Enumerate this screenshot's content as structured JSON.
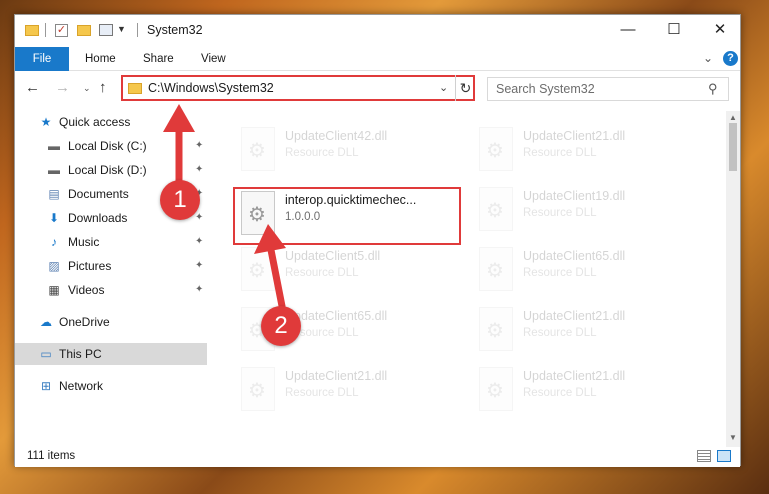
{
  "titlebar": {
    "title": "System32",
    "quick_access_icons": [
      "folder-icon",
      "properties-check-icon",
      "new-folder-icon",
      "properties-icon",
      "customize-dropdown-icon"
    ],
    "minimize": "—",
    "maximize": "☐",
    "close": "✕"
  },
  "ribbon": {
    "tabs": [
      "File",
      "Home",
      "Share",
      "View"
    ],
    "expand": "⌄",
    "help": "?"
  },
  "nav": {
    "back": "←",
    "forward": "→",
    "recent": "⌄",
    "up": "↑",
    "address": "C:\\Windows\\System32",
    "address_dropdown": "⌄",
    "refresh": "↻",
    "search_placeholder": "Search System32",
    "search_icon": "⚲"
  },
  "sidebar": {
    "items": [
      {
        "label": "Quick access",
        "icon": "star-icon",
        "glyph": "★",
        "pinned": false
      },
      {
        "label": "Local Disk (C:)",
        "icon": "drive-icon",
        "glyph": "▬",
        "pinned": true
      },
      {
        "label": "Local Disk (D:)",
        "icon": "drive-icon",
        "glyph": "▬",
        "pinned": true
      },
      {
        "label": "Documents",
        "icon": "documents-icon",
        "glyph": "▤",
        "pinned": true
      },
      {
        "label": "Downloads",
        "icon": "download-icon",
        "glyph": "⬇",
        "pinned": true
      },
      {
        "label": "Music",
        "icon": "music-icon",
        "glyph": "♪",
        "pinned": true
      },
      {
        "label": "Pictures",
        "icon": "pictures-icon",
        "glyph": "▨",
        "pinned": true
      },
      {
        "label": "Videos",
        "icon": "videos-icon",
        "glyph": "▦",
        "pinned": true
      },
      {
        "label": "OneDrive",
        "icon": "cloud-icon",
        "glyph": "☁",
        "pinned": false
      },
      {
        "label": "This PC",
        "icon": "computer-icon",
        "glyph": "▭",
        "pinned": false
      },
      {
        "label": "Network",
        "icon": "network-icon",
        "glyph": "⊞",
        "pinned": false
      }
    ],
    "pin_glyph": "📌"
  },
  "files": [
    {
      "name": "UpdateClient42.dll",
      "type": "Resource DLL"
    },
    {
      "name": "UpdateClient21.dll",
      "type": "Resource DLL"
    },
    {
      "name": "interop.quicktimechec...",
      "type": "1.0.0.0"
    },
    {
      "name": "UpdateClient19.dll",
      "type": "Resource DLL"
    },
    {
      "name": "UpdateClient5.dll",
      "type": "Resource DLL"
    },
    {
      "name": "UpdateClient65.dll",
      "type": "Resource DLL"
    },
    {
      "name": "UpdateClient65.dll",
      "type": "Resource DLL"
    },
    {
      "name": "UpdateClient21.dll",
      "type": "Resource DLL"
    },
    {
      "name": "UpdateClient21.dll",
      "type": "Resource DLL"
    },
    {
      "name": "UpdateClient21.dll",
      "type": "Resource DLL"
    }
  ],
  "status": {
    "items_count": "111 items"
  },
  "annotations": {
    "step1": "1",
    "step2": "2",
    "color": "#e03a3a"
  }
}
